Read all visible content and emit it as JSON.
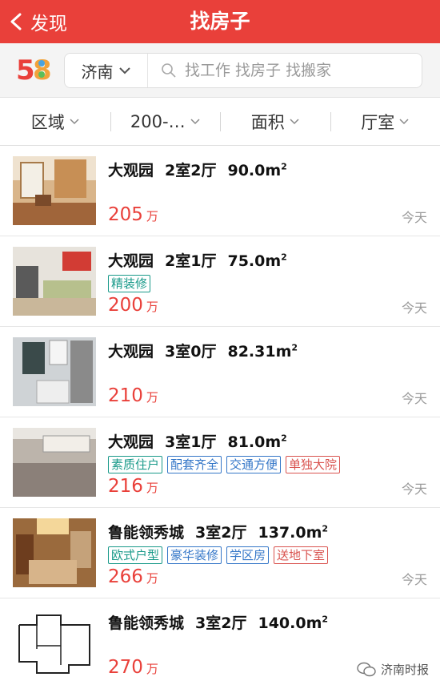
{
  "nav": {
    "back_label": "发现",
    "title": "找房子"
  },
  "search": {
    "city": "济南",
    "placeholder": "找工作 找房子 找搬家"
  },
  "brand": {
    "logo_text": "58"
  },
  "filters": [
    {
      "label": "区域"
    },
    {
      "label": "200-…"
    },
    {
      "label": "面积"
    },
    {
      "label": "厅室"
    }
  ],
  "listings": [
    {
      "community": "大观园",
      "layout": "2室2厅",
      "area": "90.0m",
      "tags": [],
      "price": "205",
      "unit": "万",
      "date": "今天"
    },
    {
      "community": "大观园",
      "layout": "2室1厅",
      "area": "75.0m",
      "tags": [
        {
          "text": "精装修",
          "color": "green"
        }
      ],
      "price": "200",
      "unit": "万",
      "date": "今天"
    },
    {
      "community": "大观园",
      "layout": "3室0厅",
      "area": "82.31m",
      "tags": [],
      "price": "210",
      "unit": "万",
      "date": "今天"
    },
    {
      "community": "大观园",
      "layout": "3室1厅",
      "area": "81.0m",
      "tags": [
        {
          "text": "素质住户",
          "color": "green"
        },
        {
          "text": "配套齐全",
          "color": "blue"
        },
        {
          "text": "交通方便",
          "color": "blue"
        },
        {
          "text": "单独大院",
          "color": "red"
        }
      ],
      "price": "216",
      "unit": "万",
      "date": "今天"
    },
    {
      "community": "鲁能领秀城",
      "layout": "3室2厅",
      "area": "137.0m",
      "tags": [
        {
          "text": "欧式户型",
          "color": "green"
        },
        {
          "text": "豪华装修",
          "color": "blue"
        },
        {
          "text": "学区房",
          "color": "blue"
        },
        {
          "text": "送地下室",
          "color": "red"
        }
      ],
      "price": "266",
      "unit": "万",
      "date": "今天"
    },
    {
      "community": "鲁能领秀城",
      "layout": "3室2厅",
      "area": "140.0m",
      "tags": [],
      "price": "270",
      "unit": "万",
      "date": ""
    }
  ],
  "watermark": {
    "text": "济南时报"
  },
  "colors": {
    "accent": "#e9403a",
    "tag_green": "#1a9a8a",
    "tag_blue": "#3577c8",
    "tag_red": "#d9534f"
  }
}
